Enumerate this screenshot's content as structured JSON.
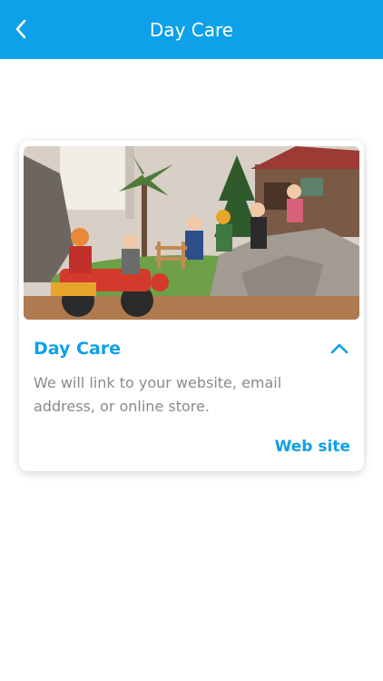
{
  "header": {
    "title": "Day Care",
    "back_icon": "chevron-left-icon",
    "background_color": "#0ea0e8"
  },
  "card": {
    "title": "Day Care",
    "description": "We will link to your website, email address, or online store.",
    "link_label": "Web site",
    "collapse_icon": "chevron-up-icon",
    "accent_color": "#0ea0e8",
    "image_subject": "toy-figures-playset-photo"
  }
}
